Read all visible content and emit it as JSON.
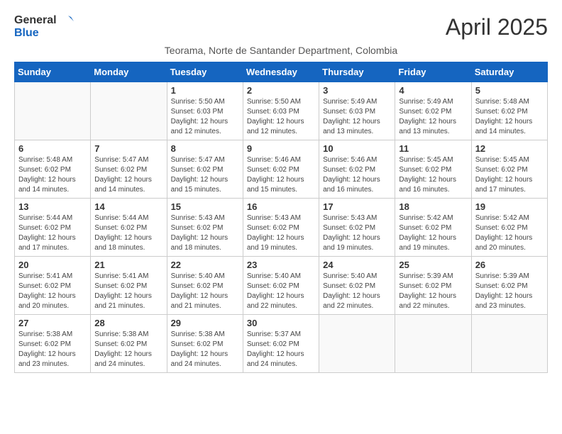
{
  "header": {
    "logo_general": "General",
    "logo_blue": "Blue",
    "month": "April 2025",
    "subtitle": "Teorama, Norte de Santander Department, Colombia"
  },
  "days_of_week": [
    "Sunday",
    "Monday",
    "Tuesday",
    "Wednesday",
    "Thursday",
    "Friday",
    "Saturday"
  ],
  "weeks": [
    [
      {
        "num": "",
        "info": ""
      },
      {
        "num": "",
        "info": ""
      },
      {
        "num": "1",
        "info": "Sunrise: 5:50 AM\nSunset: 6:03 PM\nDaylight: 12 hours and 12 minutes."
      },
      {
        "num": "2",
        "info": "Sunrise: 5:50 AM\nSunset: 6:03 PM\nDaylight: 12 hours and 12 minutes."
      },
      {
        "num": "3",
        "info": "Sunrise: 5:49 AM\nSunset: 6:03 PM\nDaylight: 12 hours and 13 minutes."
      },
      {
        "num": "4",
        "info": "Sunrise: 5:49 AM\nSunset: 6:02 PM\nDaylight: 12 hours and 13 minutes."
      },
      {
        "num": "5",
        "info": "Sunrise: 5:48 AM\nSunset: 6:02 PM\nDaylight: 12 hours and 14 minutes."
      }
    ],
    [
      {
        "num": "6",
        "info": "Sunrise: 5:48 AM\nSunset: 6:02 PM\nDaylight: 12 hours and 14 minutes."
      },
      {
        "num": "7",
        "info": "Sunrise: 5:47 AM\nSunset: 6:02 PM\nDaylight: 12 hours and 14 minutes."
      },
      {
        "num": "8",
        "info": "Sunrise: 5:47 AM\nSunset: 6:02 PM\nDaylight: 12 hours and 15 minutes."
      },
      {
        "num": "9",
        "info": "Sunrise: 5:46 AM\nSunset: 6:02 PM\nDaylight: 12 hours and 15 minutes."
      },
      {
        "num": "10",
        "info": "Sunrise: 5:46 AM\nSunset: 6:02 PM\nDaylight: 12 hours and 16 minutes."
      },
      {
        "num": "11",
        "info": "Sunrise: 5:45 AM\nSunset: 6:02 PM\nDaylight: 12 hours and 16 minutes."
      },
      {
        "num": "12",
        "info": "Sunrise: 5:45 AM\nSunset: 6:02 PM\nDaylight: 12 hours and 17 minutes."
      }
    ],
    [
      {
        "num": "13",
        "info": "Sunrise: 5:44 AM\nSunset: 6:02 PM\nDaylight: 12 hours and 17 minutes."
      },
      {
        "num": "14",
        "info": "Sunrise: 5:44 AM\nSunset: 6:02 PM\nDaylight: 12 hours and 18 minutes."
      },
      {
        "num": "15",
        "info": "Sunrise: 5:43 AM\nSunset: 6:02 PM\nDaylight: 12 hours and 18 minutes."
      },
      {
        "num": "16",
        "info": "Sunrise: 5:43 AM\nSunset: 6:02 PM\nDaylight: 12 hours and 19 minutes."
      },
      {
        "num": "17",
        "info": "Sunrise: 5:43 AM\nSunset: 6:02 PM\nDaylight: 12 hours and 19 minutes."
      },
      {
        "num": "18",
        "info": "Sunrise: 5:42 AM\nSunset: 6:02 PM\nDaylight: 12 hours and 19 minutes."
      },
      {
        "num": "19",
        "info": "Sunrise: 5:42 AM\nSunset: 6:02 PM\nDaylight: 12 hours and 20 minutes."
      }
    ],
    [
      {
        "num": "20",
        "info": "Sunrise: 5:41 AM\nSunset: 6:02 PM\nDaylight: 12 hours and 20 minutes."
      },
      {
        "num": "21",
        "info": "Sunrise: 5:41 AM\nSunset: 6:02 PM\nDaylight: 12 hours and 21 minutes."
      },
      {
        "num": "22",
        "info": "Sunrise: 5:40 AM\nSunset: 6:02 PM\nDaylight: 12 hours and 21 minutes."
      },
      {
        "num": "23",
        "info": "Sunrise: 5:40 AM\nSunset: 6:02 PM\nDaylight: 12 hours and 22 minutes."
      },
      {
        "num": "24",
        "info": "Sunrise: 5:40 AM\nSunset: 6:02 PM\nDaylight: 12 hours and 22 minutes."
      },
      {
        "num": "25",
        "info": "Sunrise: 5:39 AM\nSunset: 6:02 PM\nDaylight: 12 hours and 22 minutes."
      },
      {
        "num": "26",
        "info": "Sunrise: 5:39 AM\nSunset: 6:02 PM\nDaylight: 12 hours and 23 minutes."
      }
    ],
    [
      {
        "num": "27",
        "info": "Sunrise: 5:38 AM\nSunset: 6:02 PM\nDaylight: 12 hours and 23 minutes."
      },
      {
        "num": "28",
        "info": "Sunrise: 5:38 AM\nSunset: 6:02 PM\nDaylight: 12 hours and 24 minutes."
      },
      {
        "num": "29",
        "info": "Sunrise: 5:38 AM\nSunset: 6:02 PM\nDaylight: 12 hours and 24 minutes."
      },
      {
        "num": "30",
        "info": "Sunrise: 5:37 AM\nSunset: 6:02 PM\nDaylight: 12 hours and 24 minutes."
      },
      {
        "num": "",
        "info": ""
      },
      {
        "num": "",
        "info": ""
      },
      {
        "num": "",
        "info": ""
      }
    ]
  ]
}
